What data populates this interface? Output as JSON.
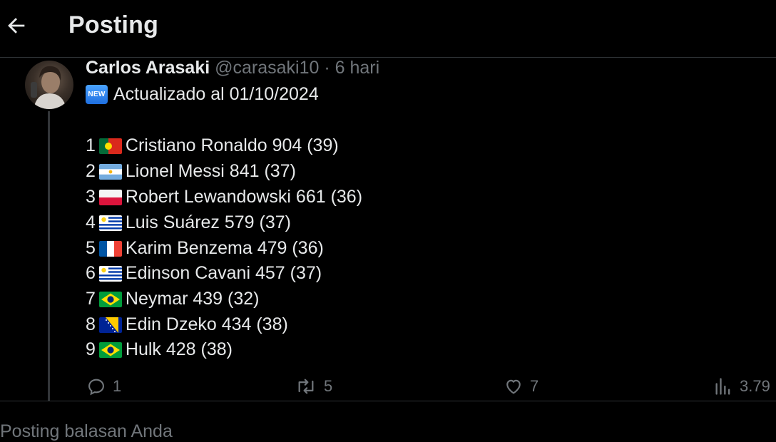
{
  "header": {
    "title": "Posting"
  },
  "tweet": {
    "author_name": "Carlos Arasaki",
    "handle": "@carasaki10",
    "separator": "·",
    "time": "6 hari",
    "badge_text": "NEW",
    "headline": "Actualizado al 01/10/2024",
    "ranking": [
      {
        "rank": "1",
        "flag": "portugal-flag-icon",
        "text": "Cristiano Ronaldo 904 (39)"
      },
      {
        "rank": "2",
        "flag": "argentina-flag-icon",
        "text": "Lionel Messi 841 (37)"
      },
      {
        "rank": "3",
        "flag": "poland-flag-icon",
        "text": "Robert Lewandowski 661 (36)"
      },
      {
        "rank": "4",
        "flag": "uruguay-flag-icon",
        "text": "Luis Suárez 579 (37)"
      },
      {
        "rank": "5",
        "flag": "france-flag-icon",
        "text": "Karim Benzema 479 (36)"
      },
      {
        "rank": "6",
        "flag": "uruguay-flag-icon",
        "text": "Edinson Cavani 457 (37)"
      },
      {
        "rank": "7",
        "flag": "brazil-flag-icon",
        "text": "Neymar 439 (32)"
      },
      {
        "rank": "8",
        "flag": "bosnia-flag-icon",
        "text": "Edin Dzeko 434 (38)"
      },
      {
        "rank": "9",
        "flag": "brazil-flag-icon",
        "text": "Hulk 428 (38)"
      }
    ]
  },
  "actions": {
    "reply_count": "1",
    "repost_count": "5",
    "like_count": "7",
    "views_count": "3.79"
  },
  "reply_prompt": "Posting balasan Anda",
  "colors": {
    "background": "#000000",
    "text": "#e7e9ea",
    "muted": "#71767b",
    "divider": "#2f3336"
  }
}
